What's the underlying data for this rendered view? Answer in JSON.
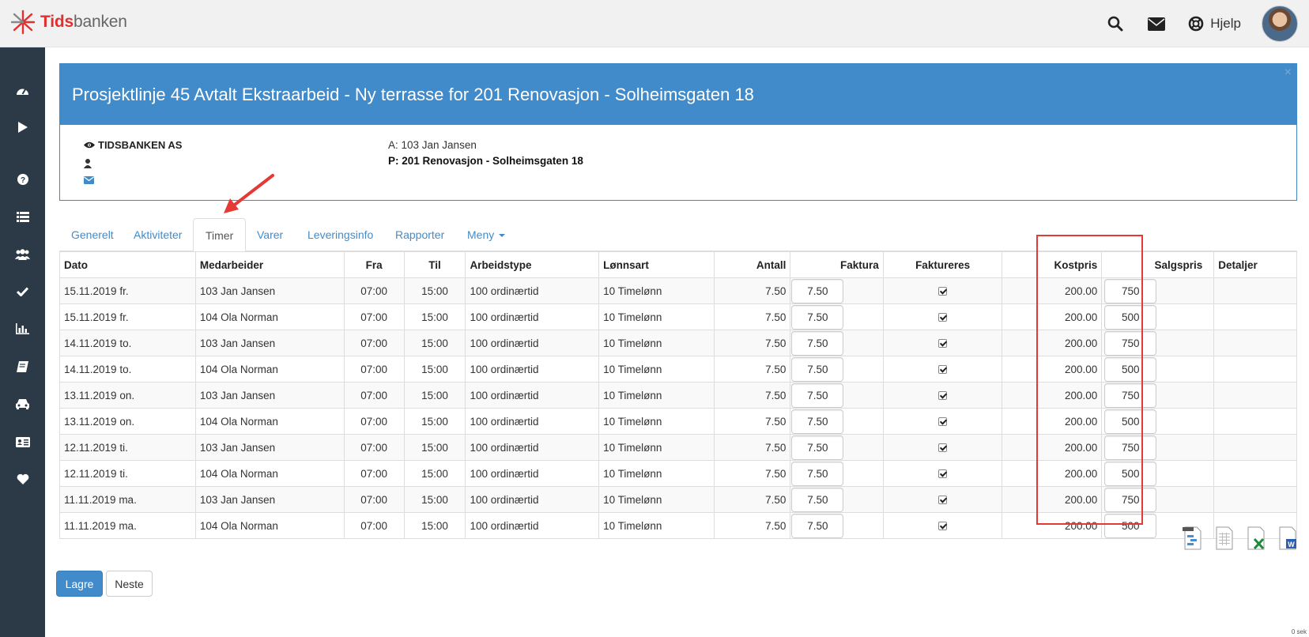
{
  "brand": {
    "part1": "Tids",
    "part2": "banken"
  },
  "topbar": {
    "help_label": "Hjelp"
  },
  "panel": {
    "title": "Prosjektlinje 45 Avtalt Ekstraarbeid - Ny terrasse for 201 Renovasjon - Solheimsgaten 18",
    "company": "TIDSBANKEN AS",
    "assignee": "A: 103 Jan Jansen",
    "project": "P: 201 Renovasjon - Solheimsgaten 18",
    "close": "×"
  },
  "tabs": [
    "Generelt",
    "Aktiviteter",
    "Timer",
    "Varer",
    "Leveringsinfo",
    "Rapporter",
    "Meny"
  ],
  "active_tab": "Timer",
  "table": {
    "headers": [
      "Dato",
      "Medarbeider",
      "Fra",
      "Til",
      "Arbeidstype",
      "Lønnsart",
      "Antall",
      "Faktura",
      "Faktureres",
      "Kostpris",
      "Salgspris",
      "Detaljer"
    ],
    "rows": [
      {
        "dato": "15.11.2019 fr.",
        "medarbeider": "103 Jan Jansen",
        "fra": "07:00",
        "til": "15:00",
        "arbeidstype": "100 ordinærtid",
        "lonnsart": "10 Timelønn",
        "antall": "7.50",
        "faktura": "7.50",
        "faktureres": true,
        "kostpris": "200.00",
        "salgspris": "750"
      },
      {
        "dato": "15.11.2019 fr.",
        "medarbeider": "104 Ola Norman",
        "fra": "07:00",
        "til": "15:00",
        "arbeidstype": "100 ordinærtid",
        "lonnsart": "10 Timelønn",
        "antall": "7.50",
        "faktura": "7.50",
        "faktureres": true,
        "kostpris": "200.00",
        "salgspris": "500"
      },
      {
        "dato": "14.11.2019 to.",
        "medarbeider": "103 Jan Jansen",
        "fra": "07:00",
        "til": "15:00",
        "arbeidstype": "100 ordinærtid",
        "lonnsart": "10 Timelønn",
        "antall": "7.50",
        "faktura": "7.50",
        "faktureres": true,
        "kostpris": "200.00",
        "salgspris": "750"
      },
      {
        "dato": "14.11.2019 to.",
        "medarbeider": "104 Ola Norman",
        "fra": "07:00",
        "til": "15:00",
        "arbeidstype": "100 ordinærtid",
        "lonnsart": "10 Timelønn",
        "antall": "7.50",
        "faktura": "7.50",
        "faktureres": true,
        "kostpris": "200.00",
        "salgspris": "500"
      },
      {
        "dato": "13.11.2019 on.",
        "medarbeider": "103 Jan Jansen",
        "fra": "07:00",
        "til": "15:00",
        "arbeidstype": "100 ordinærtid",
        "lonnsart": "10 Timelønn",
        "antall": "7.50",
        "faktura": "7.50",
        "faktureres": true,
        "kostpris": "200.00",
        "salgspris": "750"
      },
      {
        "dato": "13.11.2019 on.",
        "medarbeider": "104 Ola Norman",
        "fra": "07:00",
        "til": "15:00",
        "arbeidstype": "100 ordinærtid",
        "lonnsart": "10 Timelønn",
        "antall": "7.50",
        "faktura": "7.50",
        "faktureres": true,
        "kostpris": "200.00",
        "salgspris": "500"
      },
      {
        "dato": "12.11.2019 ti.",
        "medarbeider": "103 Jan Jansen",
        "fra": "07:00",
        "til": "15:00",
        "arbeidstype": "100 ordinærtid",
        "lonnsart": "10 Timelønn",
        "antall": "7.50",
        "faktura": "7.50",
        "faktureres": true,
        "kostpris": "200.00",
        "salgspris": "750"
      },
      {
        "dato": "12.11.2019 ti.",
        "medarbeider": "104 Ola Norman",
        "fra": "07:00",
        "til": "15:00",
        "arbeidstype": "100 ordinærtid",
        "lonnsart": "10 Timelønn",
        "antall": "7.50",
        "faktura": "7.50",
        "faktureres": true,
        "kostpris": "200.00",
        "salgspris": "500"
      },
      {
        "dato": "11.11.2019 ma.",
        "medarbeider": "103 Jan Jansen",
        "fra": "07:00",
        "til": "15:00",
        "arbeidstype": "100 ordinærtid",
        "lonnsart": "10 Timelønn",
        "antall": "7.50",
        "faktura": "7.50",
        "faktureres": true,
        "kostpris": "200.00",
        "salgspris": "750"
      },
      {
        "dato": "11.11.2019 ma.",
        "medarbeider": "104 Ola Norman",
        "fra": "07:00",
        "til": "15:00",
        "arbeidstype": "100 ordinærtid",
        "lonnsart": "10 Timelønn",
        "antall": "7.50",
        "faktura": "7.50",
        "faktureres": true,
        "kostpris": "200.00",
        "salgspris": "500"
      }
    ]
  },
  "buttons": {
    "save": "Lagre",
    "next": "Neste"
  },
  "footer_timer": "0 sek",
  "colors": {
    "brand_red": "#e03030",
    "primary": "#428bca",
    "sidebar": "#2b3a46",
    "annotation": "#e53935"
  },
  "sidebar_icons": [
    "dashboard-icon",
    "play-icon",
    "question-icon",
    "list-icon",
    "users-icon",
    "check-icon",
    "bar-chart-icon",
    "book-icon",
    "car-icon",
    "id-card-icon",
    "heart-icon"
  ],
  "export_icons": [
    "export-project-icon",
    "export-calc-icon",
    "export-excel-icon",
    "export-word-icon"
  ]
}
